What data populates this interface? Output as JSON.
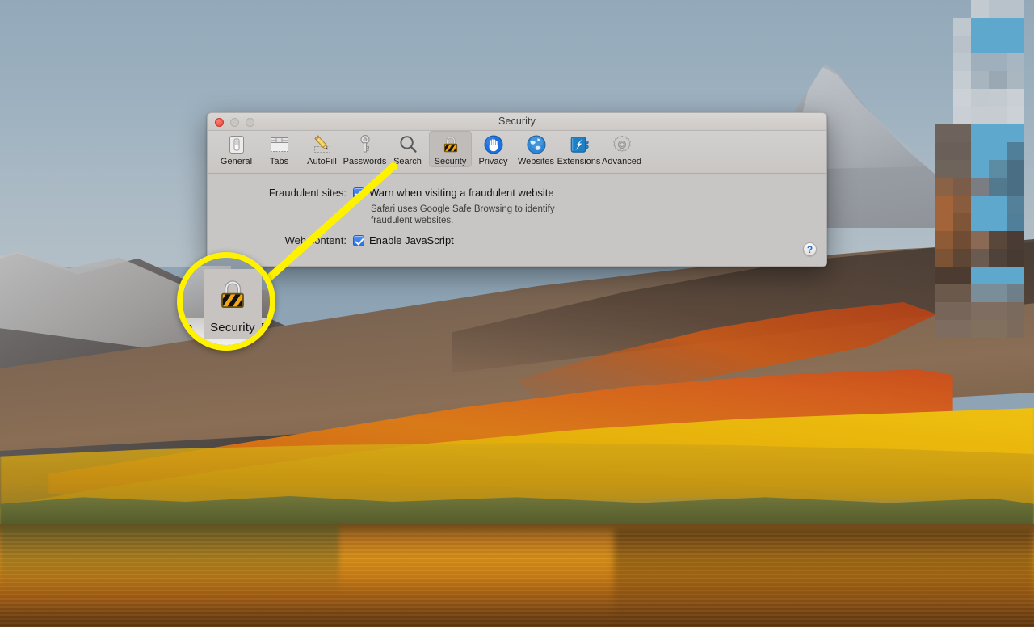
{
  "desktop": {
    "wallpaper_name": "macos-high-sierra-wallpaper",
    "redacted_block_name": "pixelated-redacted-region"
  },
  "window": {
    "title": "Security",
    "traffic_lights": {
      "close_label": "Close",
      "minimize_label": "Minimize",
      "zoom_label": "Zoom",
      "close_color": "#e0483c",
      "inactive_color": "#c9c6c3"
    },
    "toolbar": {
      "items": [
        {
          "label": "General",
          "icon": "general-icon",
          "selected": false
        },
        {
          "label": "Tabs",
          "icon": "tabs-icon",
          "selected": false
        },
        {
          "label": "AutoFill",
          "icon": "autofill-icon",
          "selected": false
        },
        {
          "label": "Passwords",
          "icon": "passwords-icon",
          "selected": false
        },
        {
          "label": "Search",
          "icon": "search-icon",
          "selected": false
        },
        {
          "label": "Security",
          "icon": "security-lock-icon",
          "selected": true
        },
        {
          "label": "Privacy",
          "icon": "privacy-hand-icon",
          "selected": false
        },
        {
          "label": "Websites",
          "icon": "websites-globe-icon",
          "selected": false
        },
        {
          "label": "Extensions",
          "icon": "extensions-icon",
          "selected": false
        },
        {
          "label": "Advanced",
          "icon": "advanced-gear-icon",
          "selected": false
        }
      ]
    },
    "content": {
      "fraudulent_sites": {
        "label": "Fraudulent sites:",
        "checkbox_label": "Warn when visiting a fraudulent website",
        "checked": true,
        "note_line1": "Safari uses Google Safe Browsing to identify",
        "note_line2": "fraudulent websites."
      },
      "web_content": {
        "label": "Web content:",
        "checkbox_label": "Enable JavaScript",
        "checked": true
      },
      "help_button_label": "?"
    }
  },
  "callout": {
    "magnifier_label": "Security",
    "magnifier_left_partial": "h",
    "magnifier_right_partial": "P",
    "highlight_color": "#fff200",
    "icon": "security-lock-icon"
  }
}
